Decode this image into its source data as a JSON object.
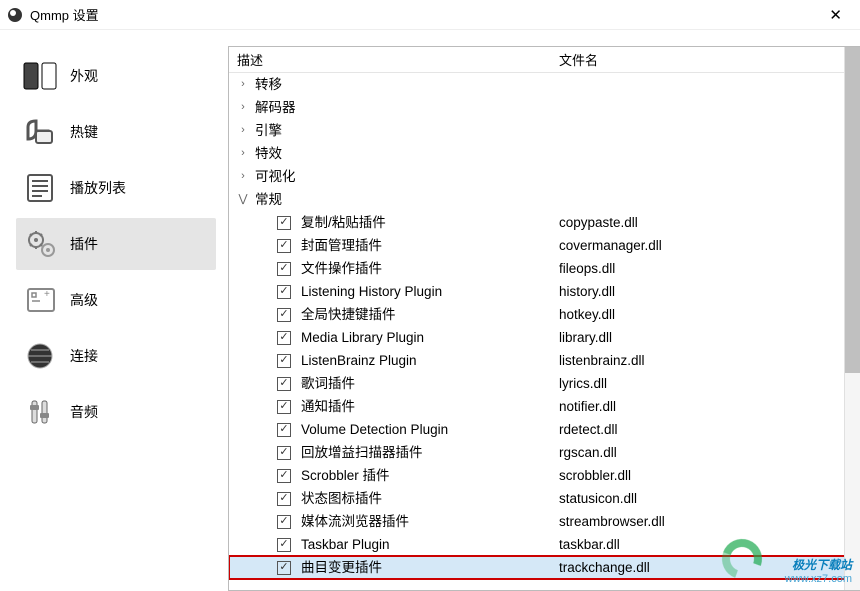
{
  "window": {
    "title": "Qmmp 设置"
  },
  "sidebar": {
    "items": [
      {
        "label": "外观"
      },
      {
        "label": "热键"
      },
      {
        "label": "播放列表"
      },
      {
        "label": "插件"
      },
      {
        "label": "高级"
      },
      {
        "label": "连接"
      },
      {
        "label": "音频"
      }
    ]
  },
  "columns": {
    "desc": "描述",
    "file": "文件名"
  },
  "tree": {
    "groups": [
      {
        "label": "转移",
        "expanded": false
      },
      {
        "label": "解码器",
        "expanded": false
      },
      {
        "label": "引擎",
        "expanded": false
      },
      {
        "label": "特效",
        "expanded": false
      },
      {
        "label": "可视化",
        "expanded": false
      },
      {
        "label": "常规",
        "expanded": true
      }
    ]
  },
  "plugins": [
    {
      "desc": "复制/粘贴插件",
      "file": "copypaste.dll",
      "checked": true
    },
    {
      "desc": "封面管理插件",
      "file": "covermanager.dll",
      "checked": true
    },
    {
      "desc": "文件操作插件",
      "file": "fileops.dll",
      "checked": true
    },
    {
      "desc": "Listening History Plugin",
      "file": "history.dll",
      "checked": true
    },
    {
      "desc": "全局快捷键插件",
      "file": "hotkey.dll",
      "checked": true
    },
    {
      "desc": "Media Library Plugin",
      "file": "library.dll",
      "checked": true
    },
    {
      "desc": "ListenBrainz Plugin",
      "file": "listenbrainz.dll",
      "checked": true
    },
    {
      "desc": "歌词插件",
      "file": "lyrics.dll",
      "checked": true
    },
    {
      "desc": "通知插件",
      "file": "notifier.dll",
      "checked": true
    },
    {
      "desc": "Volume Detection Plugin",
      "file": "rdetect.dll",
      "checked": true
    },
    {
      "desc": "回放增益扫描器插件",
      "file": "rgscan.dll",
      "checked": true
    },
    {
      "desc": "Scrobbler 插件",
      "file": "scrobbler.dll",
      "checked": true
    },
    {
      "desc": "状态图标插件",
      "file": "statusicon.dll",
      "checked": true
    },
    {
      "desc": "媒体流浏览器插件",
      "file": "streambrowser.dll",
      "checked": true
    },
    {
      "desc": "Taskbar Plugin",
      "file": "taskbar.dll",
      "checked": true
    },
    {
      "desc": "曲目变更插件",
      "file": "trackchange.dll",
      "checked": true,
      "highlight": true
    }
  ],
  "watermark": {
    "line1": "极光下载站",
    "line2": "www.xz7.com"
  }
}
